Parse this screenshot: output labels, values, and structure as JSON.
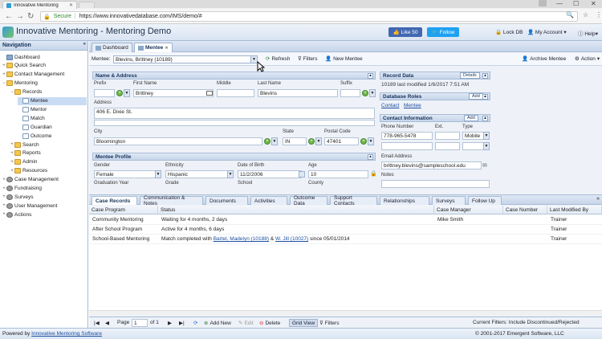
{
  "browser": {
    "tab_title": "Innovative Mentoring",
    "secure_label": "Secure",
    "url": "https://www.innovativedatabase.com/IMS/demo/#"
  },
  "app": {
    "title": "Innovative Mentoring - Mentoring Demo",
    "facebook_label": "Like 50",
    "twitter_label": "Follow",
    "lock_db": "Lock DB",
    "my_account": "My Account",
    "help": "Help"
  },
  "navigation": {
    "header": "Navigation",
    "items": [
      {
        "label": "Dashboard"
      },
      {
        "label": "Quick Search"
      },
      {
        "label": "Contact Management"
      },
      {
        "label": "Mentoring"
      },
      {
        "label": "Records"
      },
      {
        "label": "Mentee"
      },
      {
        "label": "Mentor"
      },
      {
        "label": "Match"
      },
      {
        "label": "Guardian"
      },
      {
        "label": "Outcome"
      },
      {
        "label": "Search"
      },
      {
        "label": "Reports"
      },
      {
        "label": "Admin"
      },
      {
        "label": "Resources"
      },
      {
        "label": "Case Management"
      },
      {
        "label": "Fundraising"
      },
      {
        "label": "Surveys"
      },
      {
        "label": "User Management"
      },
      {
        "label": "Actions"
      }
    ]
  },
  "main_tabs": [
    {
      "label": "Dashboard"
    },
    {
      "label": "Mentee"
    }
  ],
  "toolbar": {
    "mentee_label": "Mentee:",
    "mentee_value": "Blevins, Brittney (10189)",
    "refresh": "Refresh",
    "filters": "Filters",
    "new_mentee": "New Mentee",
    "archive_mentee": "Archive Mentee",
    "action": "Action"
  },
  "name_address": {
    "header": "Name & Address",
    "prefix_lbl": "Prefix",
    "first_lbl": "First Name",
    "first_val": "Brittney",
    "middle_lbl": "Middle",
    "last_lbl": "Last Name",
    "last_val": "Blevins",
    "suffix_lbl": "Suffix",
    "address_lbl": "Address",
    "address_val": "406 E. Dixie St.",
    "city_lbl": "City",
    "city_val": "Bloomington",
    "state_lbl": "State",
    "state_val": "IN",
    "postal_lbl": "Postal Code",
    "postal_val": "47401"
  },
  "mentee_profile": {
    "header": "Mentee Profile",
    "gender_lbl": "Gender",
    "gender_val": "Female",
    "ethnicity_lbl": "Ethnicity",
    "ethnicity_val": "Hispanic",
    "dob_lbl": "Date of Birth",
    "dob_val": "11/2/2006",
    "age_lbl": "Age",
    "age_val": "10",
    "grad_lbl": "Graduation Year",
    "grade_lbl": "Grade",
    "school_lbl": "School",
    "county_lbl": "County"
  },
  "record_data": {
    "header": "Record Data",
    "details": "Details",
    "text": "10189 last modified 1/6/2017 7:51 AM"
  },
  "db_roles": {
    "header": "Database Roles",
    "add": "Add",
    "role1": "Contact",
    "role2": "Mentee"
  },
  "contact_info": {
    "header": "Contact Information",
    "add": "Add",
    "phone_lbl": "Phone Number",
    "ext_lbl": "Ext.",
    "type_lbl": "Type",
    "phone_val": "778-965-5478",
    "type_val": "Mobile",
    "email_lbl": "Email Address",
    "email_val": "brittney.blevins@sampleschool.edu",
    "notes_lbl": "Notes"
  },
  "bottom_tabs": [
    {
      "label": "Case Records"
    },
    {
      "label": "Communication & Notes"
    },
    {
      "label": "Documents"
    },
    {
      "label": "Activities"
    },
    {
      "label": "Outcome Data"
    },
    {
      "label": "Support Contacts"
    },
    {
      "label": "Relationships"
    },
    {
      "label": "Surveys"
    },
    {
      "label": "Follow Up"
    }
  ],
  "grid": {
    "headers": [
      "Case Program",
      "Status",
      "Case Manager",
      "Case Number",
      "Last Modified By"
    ],
    "rows": [
      {
        "program": "Community Mentoring",
        "status": "Waiting for 4 months, 2 days",
        "manager": "Mike Smith",
        "number": "",
        "modified_by": "Trainer"
      },
      {
        "program": "After School Program",
        "status": "Active for 4 months, 6 days",
        "manager": "",
        "number": "",
        "modified_by": "Trainer"
      },
      {
        "program": "School-Based Mentoring",
        "status_prefix": "Match completed with",
        "link1": "Bartel, Madelyn (10188)",
        "status_mid": "&",
        "link2": "W. Jill (10027)",
        "status_suffix": "since 05/01/2014",
        "manager": "",
        "number": "",
        "modified_by": "Trainer"
      }
    ]
  },
  "pager": {
    "page_lbl": "Page",
    "page_val": "1",
    "of_lbl": "of 1",
    "add_new": "Add New",
    "edit": "Edit",
    "delete": "Delete",
    "grid_view": "Grid View",
    "filters": "Filters",
    "current_filters": "Current Filters: Include Discontinued/Rejected"
  },
  "footer": {
    "powered_prefix": "Powered by",
    "powered_link": "Innovative Mentoring Software",
    "copyright": "© 2001-2017 Emergent Software, LLC"
  },
  "colors": {
    "header_bg": "#c6d5ea",
    "selection": "#c9dcf4",
    "facebook": "#4267b2",
    "twitter": "#1da1f2",
    "link": "#1d4fa0"
  }
}
